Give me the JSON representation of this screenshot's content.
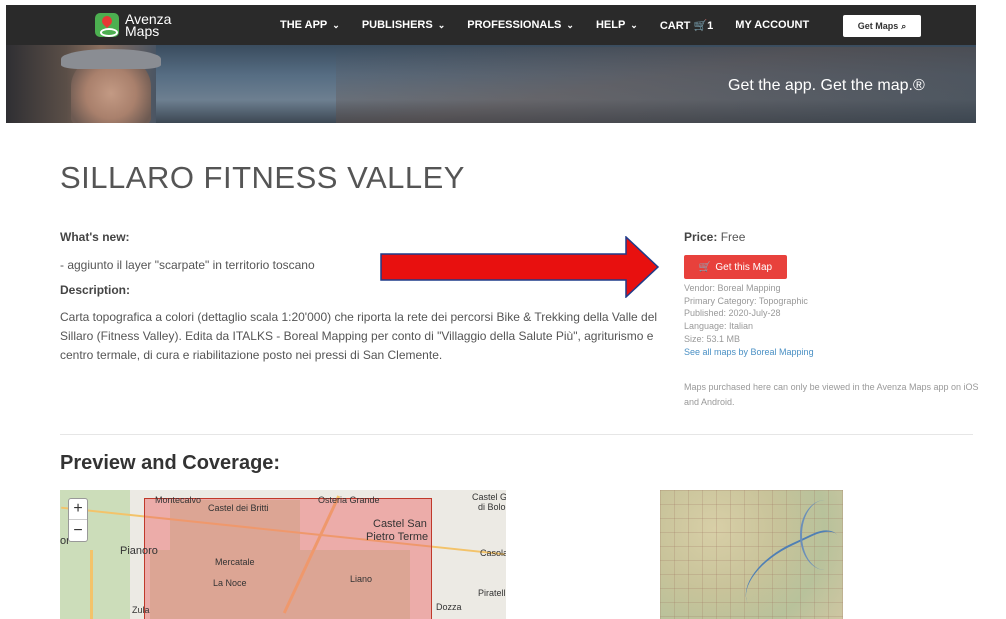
{
  "nav": {
    "logo_line1": "Avenza",
    "logo_line2": "Maps",
    "items": [
      {
        "label": "THE APP",
        "chevron": true
      },
      {
        "label": "PUBLISHERS",
        "chevron": true
      },
      {
        "label": "PROFESSIONALS",
        "chevron": true
      },
      {
        "label": "HELP",
        "chevron": true
      },
      {
        "label": "CART",
        "cart_count": "1"
      },
      {
        "label": "MY ACCOUNT"
      }
    ],
    "get_maps_label": "Get Maps"
  },
  "banner": {
    "tagline": "Get the app. Get the map.®"
  },
  "product": {
    "title": "SILLARO FITNESS VALLEY",
    "whats_new_label": "What's new:",
    "whats_new_text": "- aggiunto il layer \"scarpate\" in territorio toscano",
    "description_label": "Description:",
    "description_text": "Carta topografica a colori (dettaglio scala 1:20'000) che riporta la rete dei percorsi Bike & Trekking della Valle del Sillaro (Fitness Valley). Edita da ITALKS - Boreal Mapping per conto di \"Villaggio della Salute Più\", agriturismo e centro termale, di cura e riabilitazione posto nei pressi di San Clemente."
  },
  "purchase": {
    "price_label": "Price:",
    "price_value": "Free",
    "button_label": "Get this Map",
    "vendor": "Vendor: Boreal Mapping",
    "category": "Primary Category: Topographic",
    "published": "Published: 2020-July-28",
    "language": "Language: Italian",
    "size": "Size: 53.1 MB",
    "see_all": "See all maps by Boreal Mapping",
    "note": "Maps purchased here can only be viewed in the Avenza Maps app on iOS and Android."
  },
  "preview": {
    "heading": "Preview and Coverage:",
    "zoom_in": "+",
    "zoom_out": "−",
    "map_labels": {
      "montecalvo": "Montecalvo",
      "castel_britti": "Castel dei Britti",
      "osteria_grande": "Osteria Grande",
      "castel_bolo_1": "Castel G",
      "castel_bolo_2": "di Bolo",
      "castel_san_1": "Castel San",
      "castel_san_2": "Pietro Terme",
      "pianoro": "Pianoro",
      "or": "or",
      "mercatale": "Mercatale",
      "casola": "Casola",
      "la_noce": "La Noce",
      "liano": "Liano",
      "piratello": "Piratell",
      "zula": "Zula",
      "dozza": "Dozza"
    }
  },
  "colors": {
    "nav_bg": "#2a2a2a",
    "button_red": "#e8413c",
    "arrow_red": "#e8100f",
    "arrow_outline": "#1f3b8a",
    "link_blue": "#4a90c4"
  }
}
